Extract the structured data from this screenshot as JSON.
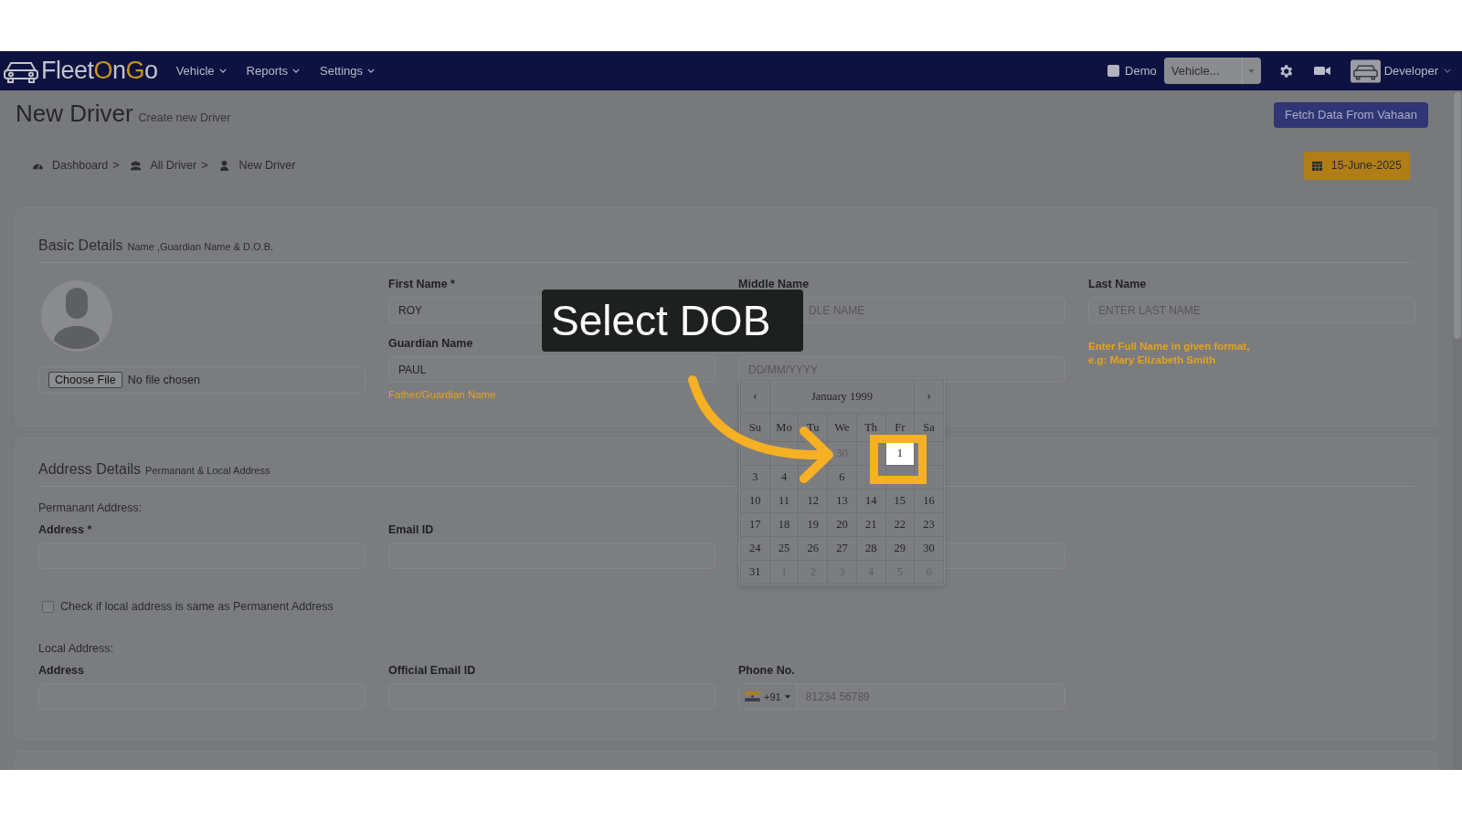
{
  "nav": {
    "logo": [
      {
        "text": "Fleet",
        "accent": false
      },
      {
        "text": "O",
        "accent": true
      },
      {
        "text": "n",
        "accent": false
      },
      {
        "text": "G",
        "accent": true
      },
      {
        "text": "o",
        "accent": false
      }
    ],
    "menus": [
      "Vehicle",
      "Reports",
      "Settings"
    ],
    "demo": {
      "label": "Demo",
      "checked": false
    },
    "vehicle_select": {
      "placeholder": "Vehicle..."
    },
    "user": "Developer"
  },
  "page": {
    "title": "New Driver",
    "subtitle": "Create new Driver",
    "fetch_button": "Fetch Data From Vahaan",
    "separator": ">",
    "breadcrumb": [
      {
        "label": "Dashboard"
      },
      {
        "label": "All Driver"
      },
      {
        "label": "New Driver"
      }
    ],
    "date_badge": "15-June-2025"
  },
  "basic_details": {
    "title": "Basic Details",
    "subtitle": "Name ,Guardian Name & D.O.B.",
    "file": {
      "button": "Choose File",
      "status": "No file chosen"
    },
    "first_name": {
      "label": "First Name *",
      "value": "ROY"
    },
    "guardian_name": {
      "label": "Guardian Name",
      "value": "PAUL",
      "helper": "Father/Guardian Name"
    },
    "middle_name": {
      "label": "Middle Name",
      "placeholder": "DLE NAME"
    },
    "date_of_birth": {
      "placeholder": "DD/MM/YYYY"
    },
    "last_name": {
      "label": "Last Name",
      "placeholder": "ENTER LAST NAME",
      "helper": [
        "Enter Full Name in given format,",
        "e.g: Mary Elizabeth Smith"
      ]
    }
  },
  "address_details": {
    "title": "Address Details",
    "subtitle": "Permanant & Local Address",
    "permanent_heading": "Permanant Address:",
    "permanent_fields": [
      {
        "label": "Address *",
        "kind": "labeled"
      },
      {
        "label": "Email ID",
        "kind": "labeled"
      },
      {
        "kind": "unlabeled"
      }
    ],
    "same_address": {
      "label": "Check if local address is same as Permanent Address",
      "checked": false
    },
    "local_heading": "Local Address:",
    "local_fields": [
      {
        "label": "Address",
        "kind": "text"
      },
      {
        "label": "Official Email ID",
        "kind": "text"
      },
      {
        "label": "Phone No.",
        "kind": "phone",
        "dial_code": "+91",
        "placeholder": "81234 56789"
      }
    ]
  },
  "calendar": {
    "month": "January 1999",
    "prev": "‹",
    "next": "›",
    "weekdays": [
      "Su",
      "Mo",
      "Tu",
      "We",
      "Th",
      "Fr",
      "Sa"
    ],
    "weeks": [
      [
        {
          "kind": "covered"
        },
        {
          "kind": "covered"
        },
        {
          "kind": "covered"
        },
        {
          "day": "30",
          "muted": true,
          "selected": false
        },
        {
          "kind": "covered"
        },
        {
          "day": "1",
          "muted": false,
          "selected": true
        },
        {
          "kind": "covered"
        }
      ],
      [
        {
          "day": "3",
          "muted": false,
          "selected": false
        },
        {
          "day": "4",
          "muted": false,
          "selected": false
        },
        {
          "kind": "covered"
        },
        {
          "day": "6",
          "muted": false,
          "selected": false
        },
        {
          "kind": "covered"
        },
        {
          "kind": "covered"
        },
        {
          "kind": "covered"
        }
      ],
      [
        {
          "day": "10",
          "muted": false,
          "selected": false
        },
        {
          "day": "11",
          "muted": false,
          "selected": false
        },
        {
          "day": "12",
          "muted": false,
          "selected": false
        },
        {
          "day": "13",
          "muted": false,
          "selected": false
        },
        {
          "day": "14",
          "muted": false,
          "selected": false
        },
        {
          "day": "15",
          "muted": false,
          "selected": false
        },
        {
          "day": "16",
          "muted": false,
          "selected": false
        }
      ],
      [
        {
          "day": "17",
          "muted": false,
          "selected": false
        },
        {
          "day": "18",
          "muted": false,
          "selected": false
        },
        {
          "day": "19",
          "muted": false,
          "selected": false
        },
        {
          "day": "20",
          "muted": false,
          "selected": false
        },
        {
          "day": "21",
          "muted": false,
          "selected": false
        },
        {
          "day": "22",
          "muted": false,
          "selected": false
        },
        {
          "day": "23",
          "muted": false,
          "selected": false
        }
      ],
      [
        {
          "day": "24",
          "muted": false,
          "selected": false
        },
        {
          "day": "25",
          "muted": false,
          "selected": false
        },
        {
          "day": "26",
          "muted": false,
          "selected": false
        },
        {
          "day": "27",
          "muted": false,
          "selected": false
        },
        {
          "day": "28",
          "muted": false,
          "selected": false
        },
        {
          "day": "29",
          "muted": false,
          "selected": false
        },
        {
          "day": "30",
          "muted": false,
          "selected": false
        }
      ],
      [
        {
          "day": "31",
          "muted": false,
          "selected": false
        },
        {
          "day": "1",
          "muted": true,
          "selected": false
        },
        {
          "day": "2",
          "muted": true,
          "selected": false
        },
        {
          "day": "3",
          "muted": true,
          "selected": false
        },
        {
          "day": "4",
          "muted": true,
          "selected": false
        },
        {
          "day": "5",
          "muted": true,
          "selected": false
        },
        {
          "day": "6",
          "muted": true,
          "selected": false
        }
      ]
    ]
  },
  "tutorial": {
    "caption": "Select DOB"
  }
}
